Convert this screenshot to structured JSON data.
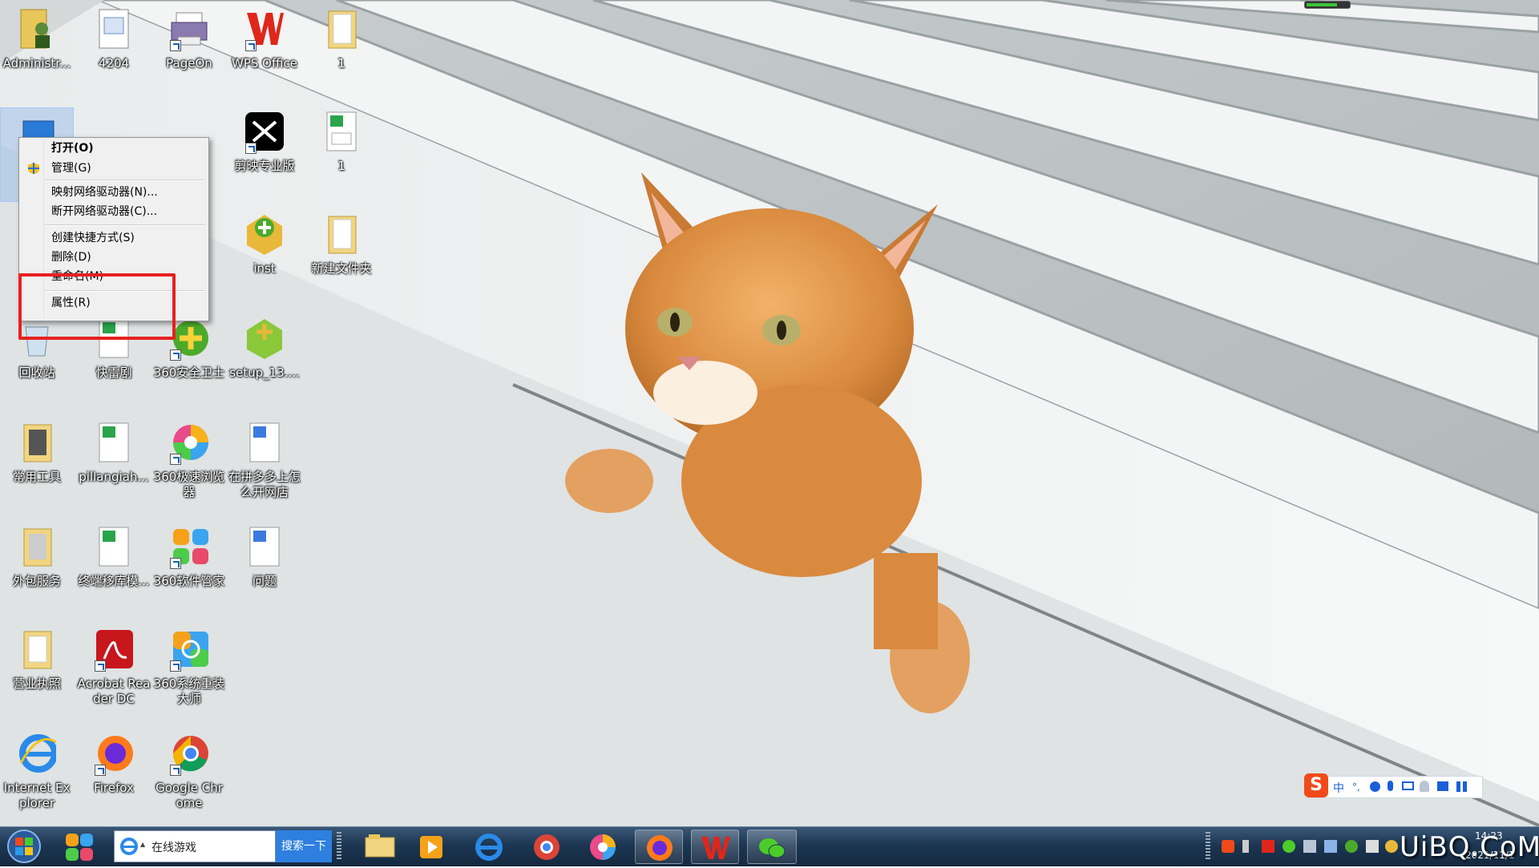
{
  "desktop": {
    "icons": [
      {
        "label": "Administr..."
      },
      {
        "label": "4204"
      },
      {
        "label": "PageOn"
      },
      {
        "label": "WPS Office"
      },
      {
        "label": "1"
      },
      {
        "label": "剪映专业版"
      },
      {
        "label": "1"
      },
      {
        "label": "inst"
      },
      {
        "label": "新建文件夹"
      },
      {
        "label": "回收站"
      },
      {
        "label": "快雷剧"
      },
      {
        "label": "360安全卫士"
      },
      {
        "label": "setup_13...."
      },
      {
        "label": "常用工具"
      },
      {
        "label": "pillangiah..."
      },
      {
        "label": "360极速浏览器"
      },
      {
        "label": "在拼多多上怎么开网店"
      },
      {
        "label": "外包服务"
      },
      {
        "label": "终端移库模..."
      },
      {
        "label": "360软件管家"
      },
      {
        "label": "问题"
      },
      {
        "label": "营业执照"
      },
      {
        "label": "Acrobat Reader DC"
      },
      {
        "label": "360系统重装大师"
      },
      {
        "label": "Internet Explorer"
      },
      {
        "label": "Firefox"
      },
      {
        "label": "Google Chrome"
      }
    ]
  },
  "context_menu": {
    "items": [
      {
        "label": "打开(O)"
      },
      {
        "label": "管理(G)"
      },
      {
        "label": "映射网络驱动器(N)..."
      },
      {
        "label": "断开网络驱动器(C)..."
      },
      {
        "label": "创建快捷方式(S)"
      },
      {
        "label": "删除(D)"
      },
      {
        "label": "重命名(M)"
      },
      {
        "label": "属性(R)"
      }
    ]
  },
  "taskbar": {
    "search_value": "在线游戏",
    "search_button": "搜索一下",
    "clock_time": "14:23",
    "clock_date": "2021/11/1"
  },
  "ime_toolbar": {
    "mode": "中"
  },
  "watermark": "UiBQ.CoM",
  "colors": {
    "highlight": "#e82020",
    "taskbar": "#1c3652",
    "search_button": "#2f7fe0"
  }
}
